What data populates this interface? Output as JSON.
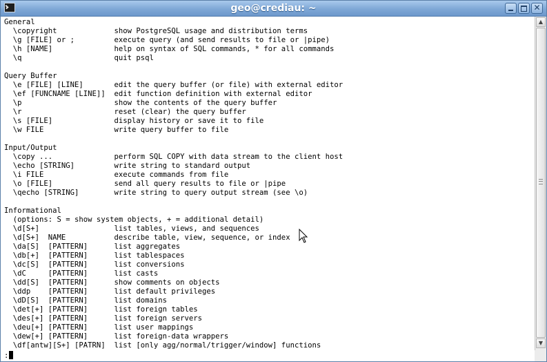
{
  "window": {
    "title": "geo@crediau: ~",
    "icons": {
      "app": "terminal-icon",
      "minimize": "minimize-icon",
      "maximize": "maximize-icon",
      "close": "close-icon"
    },
    "close_glyph": "✕"
  },
  "terminal": {
    "lines": [
      "General",
      "  \\copyright             show PostgreSQL usage and distribution terms",
      "  \\g [FILE] or ;         execute query (and send results to file or |pipe)",
      "  \\h [NAME]              help on syntax of SQL commands, * for all commands",
      "  \\q                     quit psql",
      "",
      "Query Buffer",
      "  \\e [FILE] [LINE]       edit the query buffer (or file) with external editor",
      "  \\ef [FUNCNAME [LINE]]  edit function definition with external editor",
      "  \\p                     show the contents of the query buffer",
      "  \\r                     reset (clear) the query buffer",
      "  \\s [FILE]              display history or save it to file",
      "  \\w FILE                write query buffer to file",
      "",
      "Input/Output",
      "  \\copy ...              perform SQL COPY with data stream to the client host",
      "  \\echo [STRING]         write string to standard output",
      "  \\i FILE                execute commands from file",
      "  \\o [FILE]              send all query results to file or |pipe",
      "  \\qecho [STRING]        write string to query output stream (see \\o)",
      "",
      "Informational",
      "  (options: S = show system objects, + = additional detail)",
      "  \\d[S+]                 list tables, views, and sequences",
      "  \\d[S+]  NAME           describe table, view, sequence, or index",
      "  \\da[S]  [PATTERN]      list aggregates",
      "  \\db[+]  [PATTERN]      list tablespaces",
      "  \\dc[S]  [PATTERN]      list conversions",
      "  \\dC     [PATTERN]      list casts",
      "  \\dd[S]  [PATTERN]      show comments on objects",
      "  \\ddp    [PATTERN]      list default privileges",
      "  \\dD[S]  [PATTERN]      list domains",
      "  \\det[+] [PATTERN]      list foreign tables",
      "  \\des[+] [PATTERN]      list foreign servers",
      "  \\deu[+] [PATTERN]      list user mappings",
      "  \\dew[+] [PATTERN]      list foreign-data wrappers",
      "  \\df[antw][S+] [PATRN]  list [only agg/normal/trigger/window] functions"
    ],
    "pager_prompt": ":"
  },
  "scrollbar": {
    "up_glyph": "▲",
    "down_glyph": "▼"
  },
  "colors": {
    "titlebar": "#7ea7d6",
    "terminal_bg": "#ffffff",
    "terminal_fg": "#000000"
  }
}
